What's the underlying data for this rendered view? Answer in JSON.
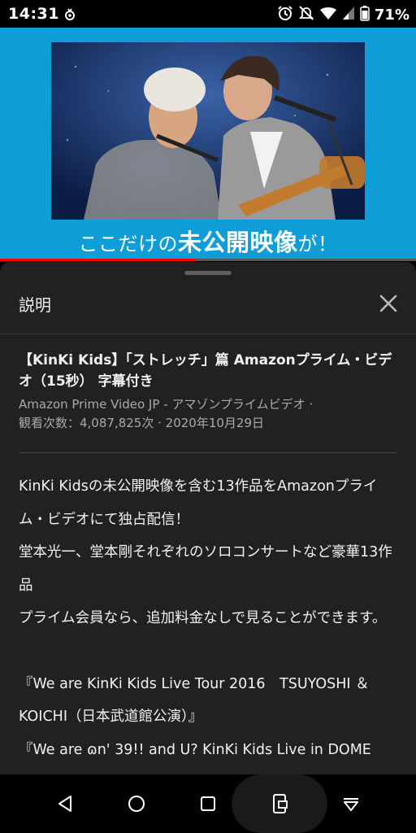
{
  "status": {
    "time": "14:31",
    "battery": "71%"
  },
  "video": {
    "caption_pre": "ここだけの",
    "caption_bold": "未公開映像",
    "caption_post": "が！",
    "progress": 0.47,
    "icons": [
      "person-silhouette"
    ]
  },
  "panel": {
    "title": "説明",
    "close_icon": "close-icon"
  },
  "info": {
    "title": "【KinKi Kids】「ストレッチ」篇 Amazonプライム・ビデオ（15秒） 字幕付き",
    "channel": "Amazon Prime Video JP - アマゾンプライムビデオ ·",
    "meta": "観看次数：4,087,825次 · 2020年10月29日"
  },
  "description": {
    "lines": [
      "KinKi Kidsの未公開映像を含む13作品をAmazonプライム・ビデオにて独占配信！",
      "堂本光一、堂本剛それぞれのソロコンサートなど豪華13作品",
      "プライム会員なら、追加料金なしで見ることができます。"
    ],
    "lines2": [
      "『We are KinKi Kids Live Tour 2016　TSUYOSHI ＆ KOICHI（日本武道館公演）』",
      "『We are ɷn' 39!! and U?  KinKi Kids Live in DOME"
    ]
  },
  "colors": {
    "video_bg": "#0e9dd6",
    "sheet_bg": "#212121",
    "progress": "#ff0000"
  }
}
